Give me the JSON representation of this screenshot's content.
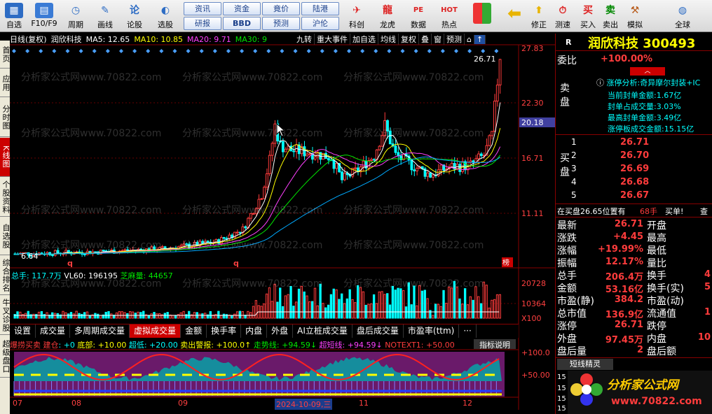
{
  "toolbar": {
    "items": [
      {
        "label": "自选",
        "icon": "grid-icon"
      },
      {
        "label": "F10/F9",
        "icon": "f10-icon"
      },
      {
        "label": "周期",
        "icon": "clock-icon"
      },
      {
        "label": "画线",
        "icon": "pen-icon"
      },
      {
        "label": "论股",
        "icon": "chat-icon"
      },
      {
        "label": "选股",
        "icon": "chart-icon"
      }
    ],
    "groups": [
      "资讯",
      "资金",
      "竟价",
      "陆港",
      "研报",
      "BBD",
      "预测",
      "沪伦"
    ],
    "right": [
      {
        "label": "科创",
        "icon": "rocket-icon"
      },
      {
        "label": "龙虎",
        "icon": "dragon-icon"
      },
      {
        "label": "数据",
        "icon": "pe-icon"
      },
      {
        "label": "热点",
        "icon": "hot-icon"
      },
      {
        "label": "",
        "icon": "doc-icon"
      }
    ],
    "tools": [
      {
        "label": "",
        "icon": "colors-icon"
      },
      {
        "label": "",
        "icon": "back-icon"
      },
      {
        "label": "",
        "icon": "up-icon"
      },
      {
        "label": "修正",
        "icon": "fix-icon"
      },
      {
        "label": "测速",
        "icon": "speed-icon"
      },
      {
        "label": "买入",
        "icon": "buy-icon"
      },
      {
        "label": "卖出",
        "icon": "sell-icon"
      },
      {
        "label": "模拟",
        "icon": "hammer-icon"
      },
      {
        "label": "全球",
        "icon": "globe-icon"
      }
    ]
  },
  "lefttabs": [
    "首页",
    "应用",
    "分时图",
    "K线图",
    "个股资料",
    "自选股",
    "综合排名",
    "牛叉诊股",
    "超级盘口"
  ],
  "chart": {
    "period": "日线(复权)",
    "name": "润欣科技",
    "ma5": "MA5: 12.65",
    "ma10": "MA10: 10.85",
    "ma20": "MA20: 9.71",
    "ma30": "MA30: 9",
    "buttons": [
      "九转",
      "重大事件",
      "加自选",
      "均线",
      "复权",
      "叠",
      "窗",
      "预测",
      "⌂",
      "↑"
    ],
    "watermark": "分析家公式网www.70822.com",
    "yticks": [
      "27.83",
      "22.30",
      "16.71",
      "11.11"
    ],
    "price_tag": "20.18",
    "high_label": "26.71",
    "low_label": "6.64",
    "list_label": "榜",
    "q_mark": "q"
  },
  "volume": {
    "total": "总手: 117.7万",
    "vl60": "VL60: 196195",
    "zhima": "芝麻量: 44657",
    "yticks": [
      "20728",
      "10364",
      "X100"
    ]
  },
  "subtabs": [
    "设置",
    "成交量",
    "多周期成交量",
    "虚拟成交量",
    "金额",
    "换手率",
    "内盘",
    "外盘",
    "AI立桩成交量",
    "盘后成交量",
    "市盈率(ttm)",
    "···"
  ],
  "indicator": {
    "items": [
      {
        "t": "爆捞买卖 建仓",
        "c": "red"
      },
      {
        "t": ": +0",
        "c": "cyan"
      },
      {
        "t": "底部: +10.00",
        "c": "yel"
      },
      {
        "t": "超低: +20.00",
        "c": "cyan"
      },
      {
        "t": "卖出警报: +100.0↑",
        "c": "yel"
      },
      {
        "t": "走势线: +94.59↓",
        "c": "grn"
      },
      {
        "t": "超短线: +94.59↓",
        "c": "mag"
      },
      {
        "t": "NOTEXT1: +50.00",
        "c": "red"
      }
    ],
    "help": "指标说明",
    "yticks": [
      "+100.0",
      "+50.00"
    ]
  },
  "dates": [
    "07",
    "08",
    "09",
    "2024-10-09,三",
    "11",
    "12"
  ],
  "rightpanel": {
    "r": "R",
    "title": "润欣科技 300493",
    "weibi_label": "委比",
    "weibi": "+100.00%",
    "limit": {
      "head": "涨停分析:奇异摩尔封装+IC",
      "rows": [
        "当前封单金额:1.67亿",
        "封单占成交量:3.03%",
        "最高封单金额:3.49亿",
        "涨停板成交金额:15.15亿"
      ]
    },
    "sell_label": "卖盘",
    "buy_label": "买盘",
    "bids": [
      {
        "n": "1",
        "p": "26.71"
      },
      {
        "n": "2",
        "p": "26.70"
      },
      {
        "n": "3",
        "p": "26.69"
      },
      {
        "n": "4",
        "p": "26.68"
      },
      {
        "n": "5",
        "p": "26.67"
      }
    ],
    "buyq": "在买盘26.65位置有",
    "buyqn": "68手",
    "buyqa": "买单!",
    "buyqb": "查",
    "quotes": [
      {
        "l": "最新",
        "v": "26.71",
        "l2": "开盘",
        "v2": ""
      },
      {
        "l": "涨跌",
        "v": "+4.45",
        "l2": "最高",
        "v2": ""
      },
      {
        "l": "涨幅",
        "v": "+19.99%",
        "l2": "最低",
        "v2": ""
      },
      {
        "l": "振幅",
        "v": "12.17%",
        "l2": "量比",
        "v2": ""
      },
      {
        "l": "总手",
        "v": "206.4万",
        "l2": "换手",
        "v2": "4"
      },
      {
        "l": "金额",
        "v": "53.16亿",
        "l2": "换手(实)",
        "v2": "5"
      },
      {
        "l": "市盈(静)",
        "v": "384.2",
        "l2": "市盈(动)",
        "v2": ""
      },
      {
        "l": "总市值",
        "v": "136.9亿",
        "l2": "流通值",
        "v2": "1"
      },
      {
        "l": "涨停",
        "v": "26.71",
        "l2": "跌停",
        "v2": ""
      },
      {
        "l": "外盘",
        "v": "97.45万",
        "l2": "内盘",
        "v2": "10"
      },
      {
        "l": "盘后量",
        "v": "2",
        "l2": "盘后额",
        "v2": ""
      }
    ],
    "short": "短线精灵",
    "short_rows": [
      "15",
      "15",
      "15",
      "15",
      "15"
    ],
    "logo_cn": "分析家公式网",
    "logo_url": "www.70822.com"
  },
  "colors": {
    "up": "#ff3c3c",
    "down": "#00ffff",
    "ma5": "#ffffff",
    "ma10": "#ffff00",
    "ma20": "#ff40ff",
    "ma30": "#00e600"
  }
}
